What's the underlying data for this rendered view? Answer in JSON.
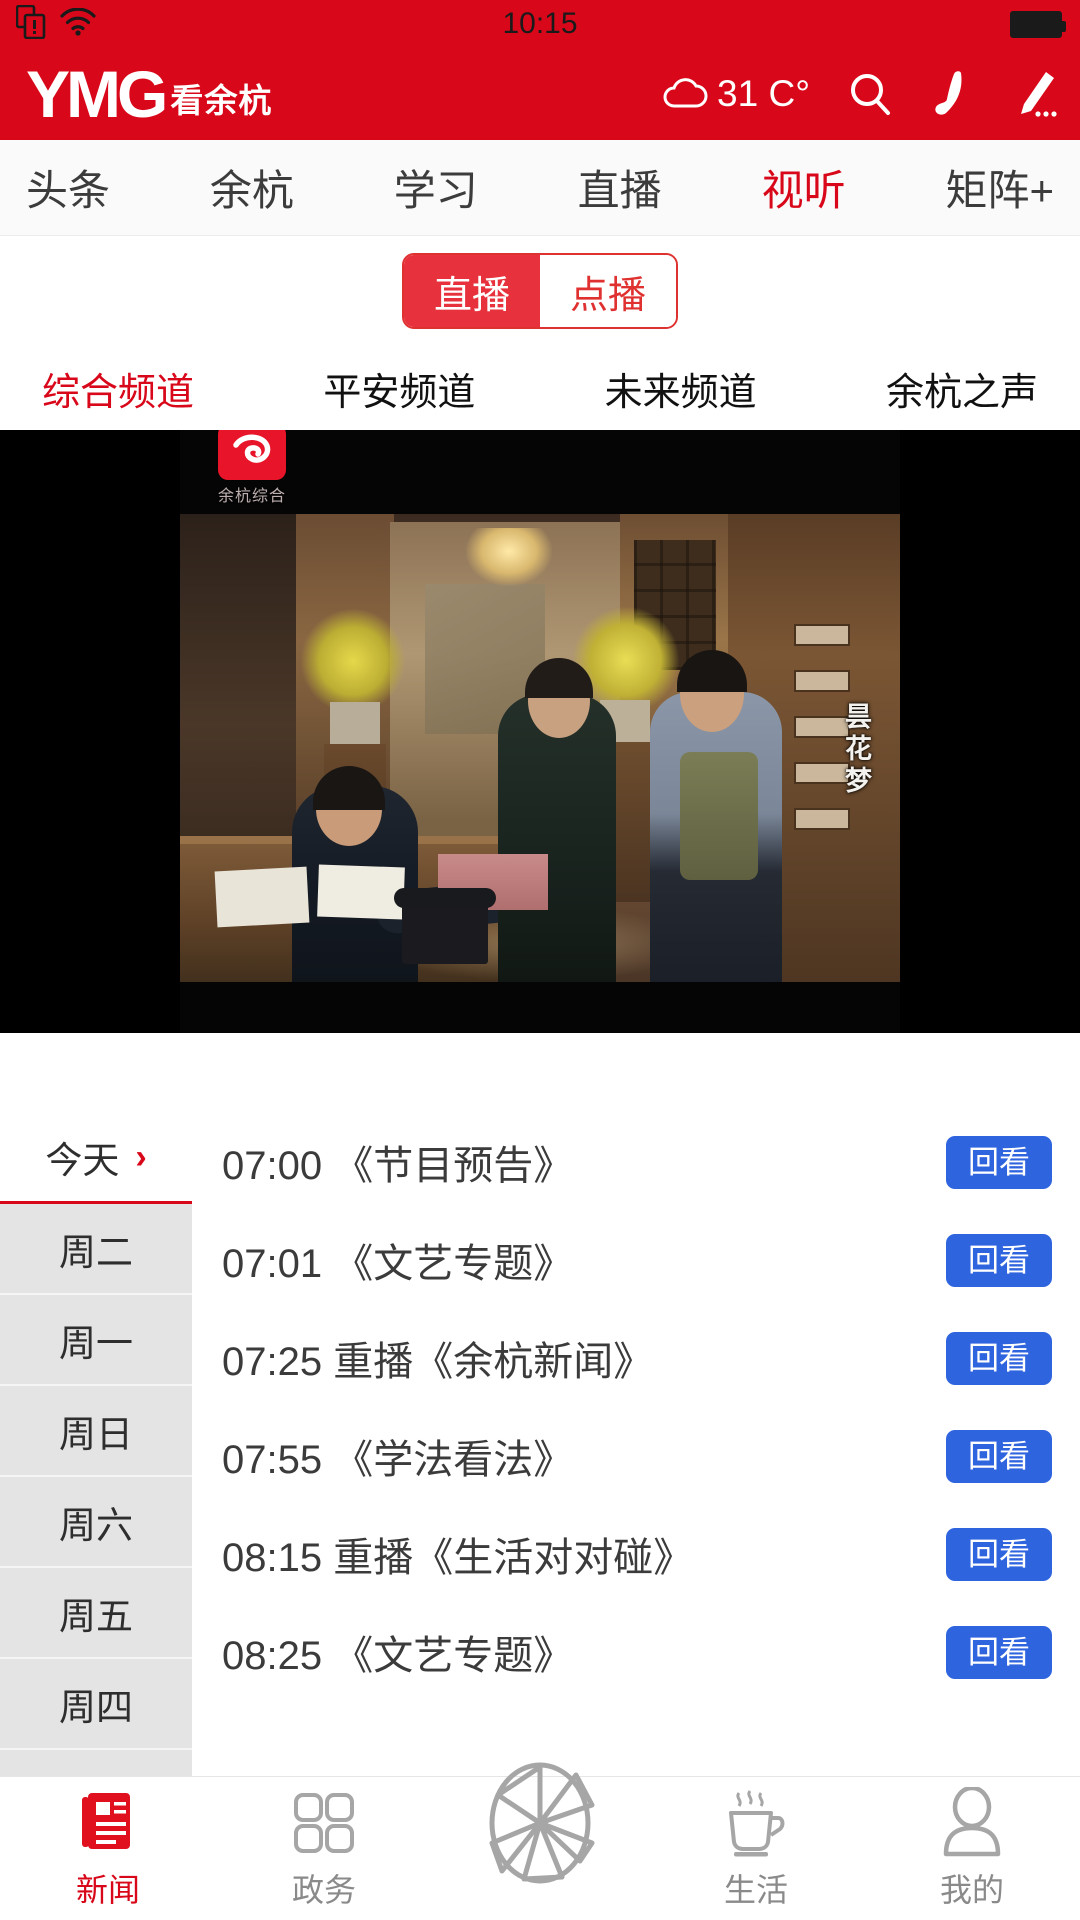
{
  "status_bar": {
    "time": "10:15",
    "icons": [
      "sim-card-alert-icon",
      "wifi-icon",
      "battery-icon"
    ]
  },
  "header": {
    "logo_main": "YMG",
    "logo_sub": "看余杭",
    "weather_temp": "31 C°",
    "weather_icon": "cloud-icon",
    "search_icon": "search-icon",
    "phone_icon": "phone-icon",
    "compose_icon": "pencil-icon"
  },
  "nav_tabs": [
    {
      "label": "头条",
      "active": false
    },
    {
      "label": "余杭",
      "active": false
    },
    {
      "label": "学习",
      "active": false
    },
    {
      "label": "直播",
      "active": false
    },
    {
      "label": "视听",
      "active": true
    },
    {
      "label": "矩阵+",
      "active": false
    }
  ],
  "segment": {
    "live_label": "直播",
    "vod_label": "点播",
    "selected": "直播"
  },
  "channels": [
    {
      "label": "综合频道",
      "active": true
    },
    {
      "label": "平安频道",
      "active": false
    },
    {
      "label": "未来频道",
      "active": false
    },
    {
      "label": "余杭之声",
      "active": false
    }
  ],
  "player": {
    "watermark_label": "余杭综合",
    "watermark_icon": "channel-logo-icon",
    "drama_title": "昙花梦"
  },
  "schedule": {
    "days": [
      {
        "label": "今天",
        "active": true,
        "chevron": "›"
      },
      {
        "label": "周二",
        "active": false
      },
      {
        "label": "周一",
        "active": false
      },
      {
        "label": "周日",
        "active": false
      },
      {
        "label": "周六",
        "active": false
      },
      {
        "label": "周五",
        "active": false
      },
      {
        "label": "周四",
        "active": false
      }
    ],
    "replay_label": "回看",
    "programs": [
      {
        "time": "07:00",
        "title": "07:00 《节目预告》"
      },
      {
        "time": "07:01",
        "title": "07:01 《文艺专题》"
      },
      {
        "time": "07:25",
        "title": "07:25 重播《余杭新闻》"
      },
      {
        "time": "07:55",
        "title": "07:55 《学法看法》"
      },
      {
        "time": "08:15",
        "title": "08:15 重播《生活对对碰》"
      },
      {
        "time": "08:25",
        "title": "08:25 《文艺专题》"
      }
    ]
  },
  "tabbar": [
    {
      "label": "新闻",
      "icon": "newspaper-icon",
      "active": true
    },
    {
      "label": "政务",
      "icon": "grid-icon",
      "active": false
    },
    {
      "label": "",
      "icon": "camera-aperture-icon",
      "active": false
    },
    {
      "label": "生活",
      "icon": "coffee-cup-icon",
      "active": false
    },
    {
      "label": "我的",
      "icon": "person-icon",
      "active": false
    }
  ],
  "colors": {
    "brand_red": "#d8081a",
    "accent_red": "#e7323e",
    "replay_blue": "#2f64df",
    "day_bg": "#e4e4e4"
  }
}
